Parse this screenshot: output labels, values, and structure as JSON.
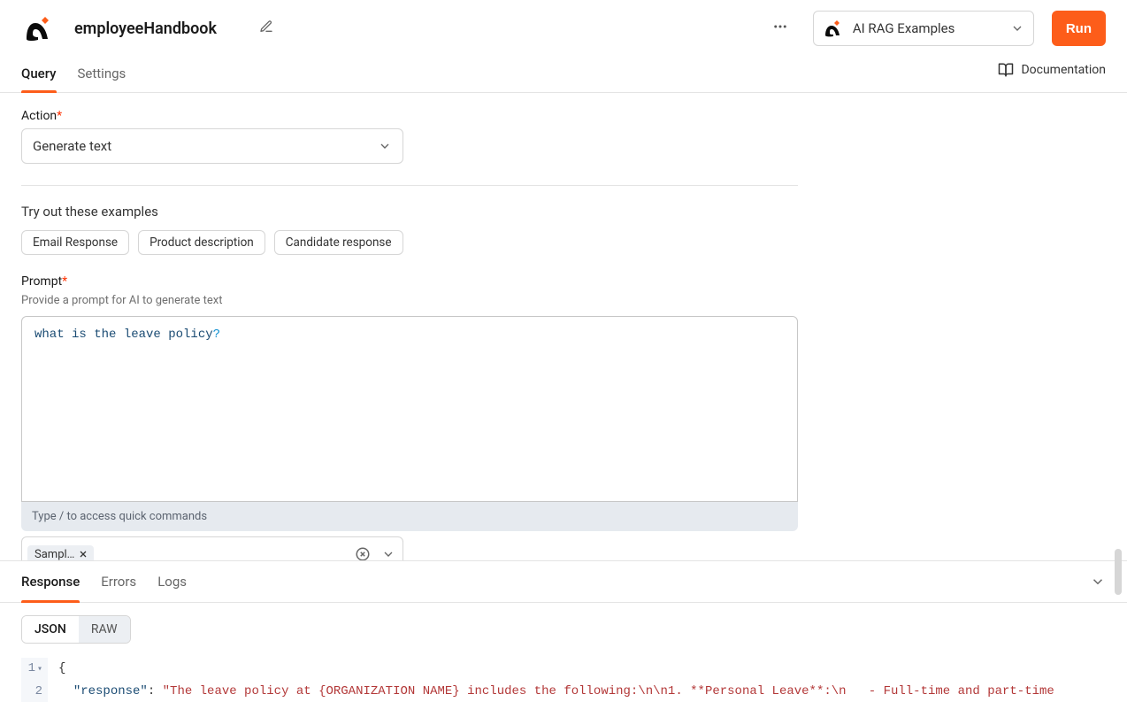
{
  "header": {
    "title": "employeeHandbook",
    "workspace": "AI RAG Examples",
    "run_label": "Run"
  },
  "tabs": {
    "query": "Query",
    "settings": "Settings",
    "documentation": "Documentation"
  },
  "action": {
    "label": "Action",
    "value": "Generate text"
  },
  "examples": {
    "heading": "Try out these examples",
    "items": [
      "Email Response",
      "Product description",
      "Candidate response"
    ]
  },
  "prompt": {
    "label": "Prompt",
    "helper": "Provide a prompt for AI to generate text",
    "value_main": "what is the leave policy",
    "value_punct": "?",
    "hint": "Type / to access quick commands"
  },
  "source_chip": "Sampl…",
  "response_tabs": {
    "response": "Response",
    "errors": "Errors",
    "logs": "Logs",
    "json": "JSON",
    "raw": "RAW"
  },
  "response_code": {
    "line1": "{",
    "line2_key": "\"response\"",
    "line2_colon": ": ",
    "line2_val": "\"The leave policy at {ORGANIZATION NAME} includes the following:\\n\\n1. **Personal Leave**:\\n   - Full-time and part-time"
  }
}
